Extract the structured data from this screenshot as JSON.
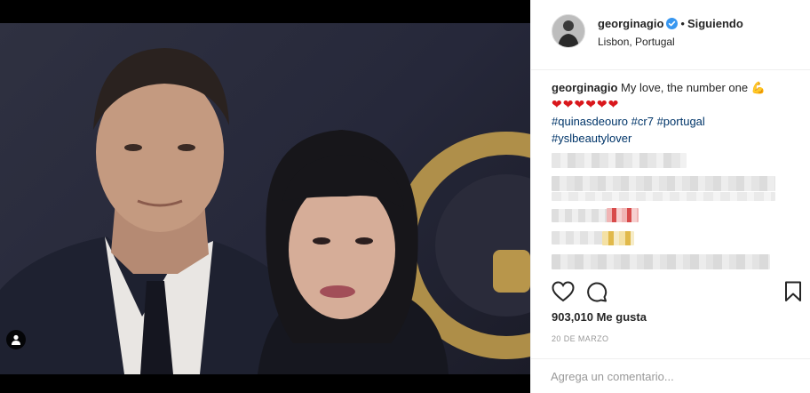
{
  "post": {
    "username": "georginagio",
    "separator": "•",
    "follow_state": "Siguiendo",
    "location": "Lisbon, Portugal",
    "verified": true
  },
  "caption": {
    "username": "georginagio",
    "text": "My love, the number one",
    "flex_emoji": "💪",
    "hearts": "❤❤❤❤❤❤",
    "hashtags_line1": [
      "#quinasdeouro",
      "#cr7",
      "#portugal"
    ],
    "hashtags_line2": [
      "#yslbeautylover"
    ]
  },
  "engagement": {
    "likes": "903,010 Me gusta",
    "date": "20 DE MARZO"
  },
  "comment": {
    "placeholder": "Agrega un comentario..."
  },
  "icons": {
    "like": "heart-icon",
    "comment": "comment-icon",
    "save": "bookmark-icon",
    "tag": "person-tag-icon",
    "verified": "verified-badge-icon"
  },
  "colors": {
    "verified": "#3897f0",
    "hashtag": "#003569",
    "text": "#262626",
    "muted": "#999999",
    "border": "#efefef"
  }
}
